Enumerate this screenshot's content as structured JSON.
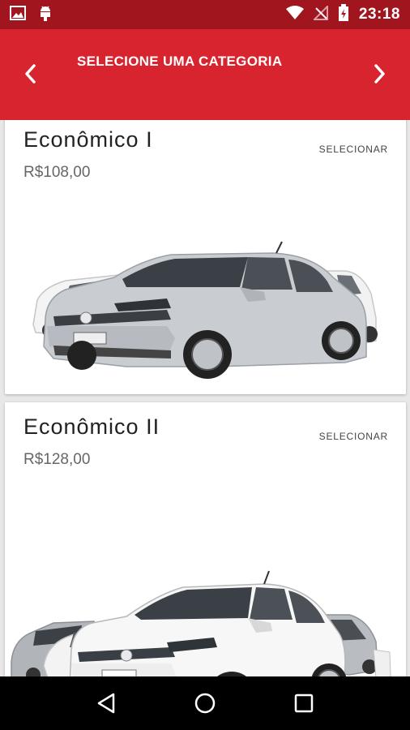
{
  "status_bar": {
    "time": "23:18",
    "icons": [
      "image-icon",
      "android-icon",
      "wifi-icon",
      "no-signal-icon",
      "battery-charging-icon"
    ]
  },
  "header": {
    "title": "SELECIONE UMA CATEGORIA",
    "prev_icon": "chevron-left-icon",
    "next_icon": "chevron-right-icon"
  },
  "categories": [
    {
      "name": "Econômico I",
      "price": "R$108,00",
      "select_label": "SELECIONAR"
    },
    {
      "name": "Econômico II",
      "price": "R$128,00",
      "select_label": "SELECIONAR"
    }
  ],
  "system_nav": {
    "back_icon": "back-triangle-icon",
    "home_icon": "home-circle-icon",
    "recents_icon": "recents-square-icon"
  },
  "colors": {
    "status_bar": "#a0151e",
    "app_bar": "#d8242f",
    "background": "#e8e8e8"
  }
}
